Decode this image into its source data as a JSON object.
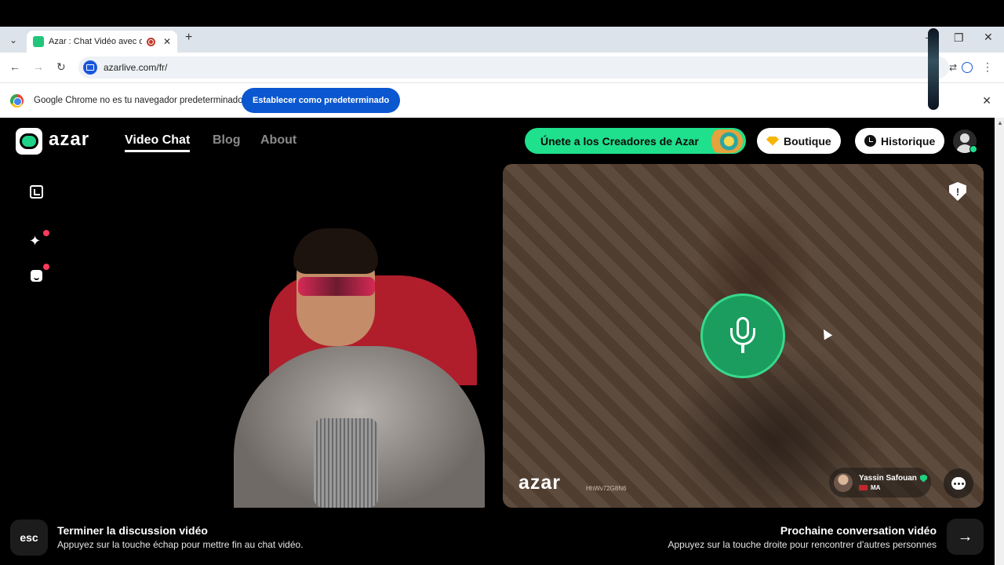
{
  "browser": {
    "tab_title": "Azar : Chat Vidéo avec de n",
    "url": "azarlive.com/fr/",
    "infobar_text": "Google Chrome no es tu navegador predeterminado",
    "infobar_button": "Establecer como predeterminado"
  },
  "header": {
    "logo": "azar",
    "nav": [
      "Video Chat",
      "Blog",
      "About"
    ],
    "creators_button": "Únete a los Creadores de Azar",
    "boutique_button": "Boutique",
    "historique_button": "Historique"
  },
  "remote": {
    "watermark": "azar",
    "id": "HhWv72G8N6",
    "peer_name": "Yassin Safouan",
    "peer_country": "MA"
  },
  "footer": {
    "esc_key": "esc",
    "end_title": "Terminer la discussion vidéo",
    "end_sub": "Appuyez sur la touche échap pour mettre fin au chat vidéo.",
    "next_title": "Prochaine conversation vidéo",
    "next_sub": "Appuyez sur la touche droite pour rencontrer d'autres personnes"
  },
  "colors": {
    "brand_green": "#1fe08c",
    "mic_green": "#1a9d5e",
    "chrome_blue": "#0b57d0"
  }
}
